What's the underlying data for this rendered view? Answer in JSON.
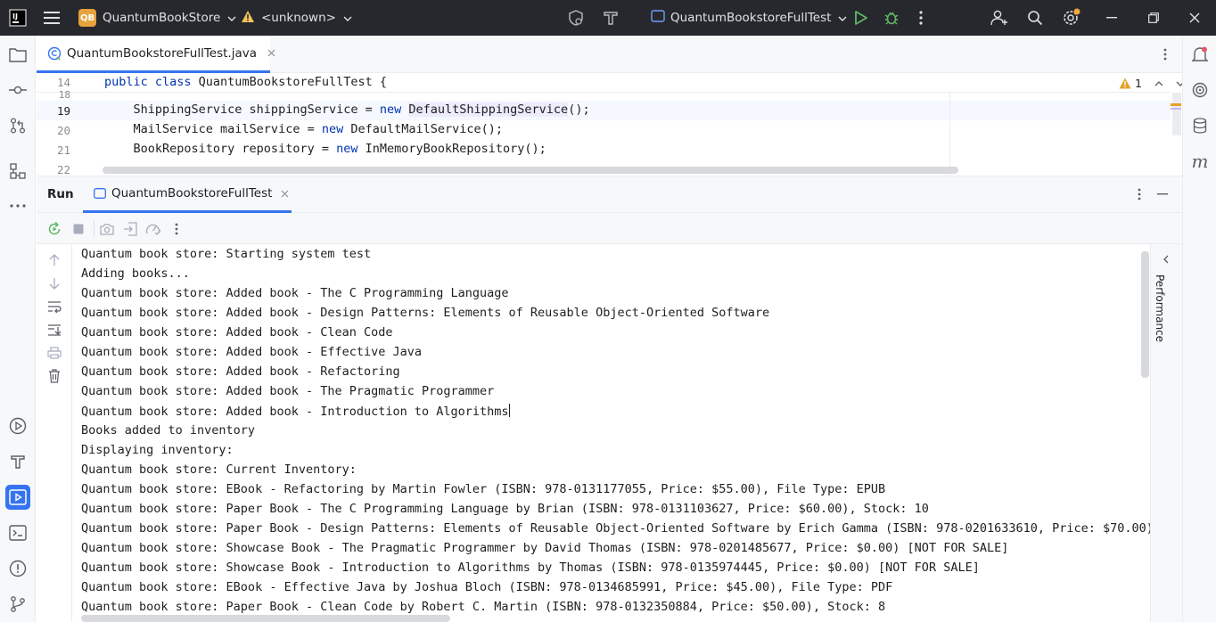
{
  "titlebar": {
    "project_badge": "QB",
    "project_name": "QuantumBookStore",
    "vcs_status": "<unknown>",
    "run_config": "QuantumBookstoreFullTest",
    "colors": {
      "bg": "#27282e",
      "badge": "#e7a23b",
      "warning": "#f2c55c",
      "run": "#5fb865",
      "notify": "#f2a83b"
    }
  },
  "editor": {
    "tab_label": "QuantumBookstoreFullTest.java",
    "sticky": {
      "line_no": "14",
      "code": "public class QuantumBookstoreFullTest {"
    },
    "lines": [
      {
        "no": "18",
        "code": ""
      },
      {
        "no": "19",
        "code": "    ShippingService shippingService = new DefaultShippingService();"
      },
      {
        "no": "20",
        "code": "    MailService mailService = new DefaultMailService();"
      },
      {
        "no": "21",
        "code": "    BookRepository repository = new InMemoryBookRepository();"
      },
      {
        "no": "22",
        "code": ""
      }
    ],
    "warning_count": "1"
  },
  "run": {
    "tool_title": "Run",
    "tab_label": "QuantumBookstoreFullTest",
    "side_label": "Performance",
    "console": [
      "Quantum book store: Starting system test",
      "Adding books...",
      "Quantum book store: Added book - The C Programming Language",
      "Quantum book store: Added book - Design Patterns: Elements of Reusable Object-Oriented Software",
      "Quantum book store: Added book - Clean Code",
      "Quantum book store: Added book - Effective Java",
      "Quantum book store: Added book - Refactoring",
      "Quantum book store: Added book - The Pragmatic Programmer",
      "Quantum book store: Added book - Introduction to Algorithms",
      "Books added to inventory",
      "Displaying inventory:",
      "Quantum book store: Current Inventory:",
      "Quantum book store: EBook - Refactoring by Martin Fowler (ISBN: 978-0131177055, Price: $55.00), File Type: EPUB",
      "Quantum book store: Paper Book - The C Programming Language by Brian (ISBN: 978-0131103627, Price: $60.00), Stock: 10",
      "Quantum book store: Paper Book - Design Patterns: Elements of Reusable Object-Oriented Software by Erich Gamma (ISBN: 978-0201633610, Price: $70.00),",
      "Quantum book store: Showcase Book - The Pragmatic Programmer by David Thomas (ISBN: 978-0201485677, Price: $0.00) [NOT FOR SALE]",
      "Quantum book store: Showcase Book - Introduction to Algorithms by Thomas (ISBN: 978-0135974445, Price: $0.00) [NOT FOR SALE]",
      "Quantum book store: EBook - Effective Java by Joshua Bloch (ISBN: 978-0134685991, Price: $45.00), File Type: PDF",
      "Quantum book store: Paper Book - Clean Code by Robert C. Martin (ISBN: 978-0132350884, Price: $50.00), Stock: 8"
    ]
  },
  "icons": {
    "left_strip": [
      "project-icon",
      "commit-icon",
      "pull-requests-icon",
      "structure-icon",
      "more-tools-icon",
      "services-icon",
      "build-icon",
      "run-icon",
      "terminal-icon",
      "problems-icon",
      "git-icon"
    ],
    "right_strip": [
      "notifications-icon",
      "ai-assistant-icon",
      "database-icon",
      "maven-icon"
    ]
  }
}
